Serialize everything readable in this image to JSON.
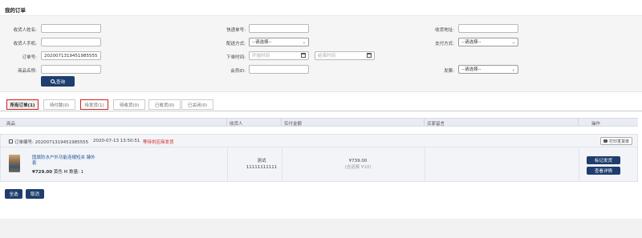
{
  "page": {
    "title": "我的订单"
  },
  "filters": {
    "receiver_name_label": "收货人姓名:",
    "receiver_phone_label": "收货人手机:",
    "order_no_label": "订单号:",
    "order_no_value": "2020071319451985555",
    "product_name_label": "商品名称:",
    "express_no_label": "快递单号:",
    "delivery_method_label": "配送方式:",
    "delivery_method_value": "--请选择--",
    "order_time_label": "下单时间:",
    "start_time_placeholder": "开始时间",
    "end_time_placeholder": "结束时间",
    "member_id_label": "会员ID:",
    "address_label": "收货地址:",
    "payment_label": "支付方式:",
    "payment_value": "--请选择--",
    "invoice_label": "发票:",
    "invoice_value": "--请选择--",
    "search_label": "查询"
  },
  "tabs": [
    {
      "label": "所有订单(1)",
      "active": true
    },
    {
      "label": "待付款(0)"
    },
    {
      "label": "待发货(1)",
      "highlighted": true
    },
    {
      "label": "待收货(0)"
    },
    {
      "label": "已收货(0)"
    },
    {
      "label": "已关闭(0)"
    }
  ],
  "table_headers": {
    "product": "商品",
    "receiver": "收货人",
    "amount": "实付金额",
    "buyer_message": "买家留言",
    "actions": "操作"
  },
  "order": {
    "order_no_label": "订单编号: 2020071319451985555",
    "time": "2020-07-13 13:50:51",
    "status": "等待供应商发货",
    "print_label": "打印发货单",
    "product_title": "国旗防水户外功能连帽短夹 臻外套",
    "price": "¥729.00",
    "specs": "黄色 M",
    "qty": "数量: 1",
    "receiver_name": "测试",
    "receiver_phone": "11111111111",
    "amount": "¥739.00",
    "shipping": "(含运费 ¥10)",
    "mark_ship_label": "标记发货",
    "view_detail_label": "查看详情"
  },
  "bottom": {
    "select_all_label": "全选",
    "cancel_label": "取消"
  },
  "colors": {
    "primary": "#1f3d6e",
    "alert": "#d32222"
  }
}
